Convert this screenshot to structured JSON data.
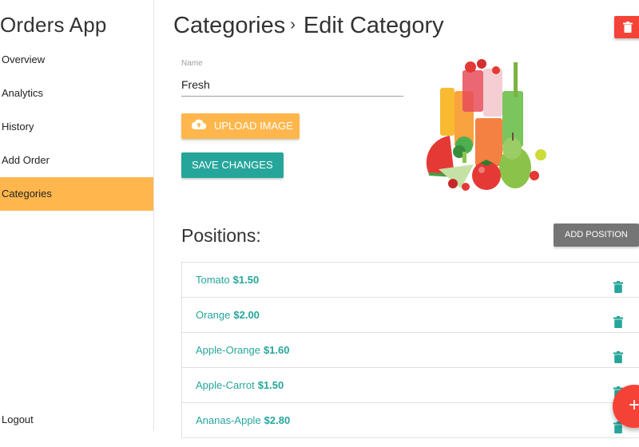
{
  "app": {
    "title": "Orders App"
  },
  "sidebar": {
    "items": [
      {
        "label": "Overview",
        "active": false
      },
      {
        "label": "Analytics",
        "active": false
      },
      {
        "label": "History",
        "active": false
      },
      {
        "label": "Add Order",
        "active": false
      },
      {
        "label": "Categories",
        "active": true
      }
    ],
    "logout_label": "Logout"
  },
  "header": {
    "breadcrumb_parent": "Categories",
    "separator": "›",
    "title": "Edit Category"
  },
  "form": {
    "name_label": "Name",
    "name_value": "Fresh",
    "upload_label": "Upload image",
    "save_label": "Save changes"
  },
  "positions": {
    "title": "Positions:",
    "add_label": "Add position",
    "items": [
      {
        "name": "Tomato",
        "price": "$1.50"
      },
      {
        "name": "Orange",
        "price": "$2.00"
      },
      {
        "name": "Apple-Orange",
        "price": "$1.60"
      },
      {
        "name": "Apple-Carrot",
        "price": "$1.50"
      },
      {
        "name": "Ananas-Apple",
        "price": "$2.80"
      }
    ]
  },
  "fab": {
    "label": "+"
  },
  "colors": {
    "accent": "#ffb74d",
    "primary": "#26a69a",
    "danger": "#f44336",
    "grey_button": "#757575"
  },
  "icons": {
    "delete_category": "trash-icon",
    "delete_position": "trash-icon",
    "upload": "cloud-upload-icon",
    "fab": "plus-icon"
  }
}
